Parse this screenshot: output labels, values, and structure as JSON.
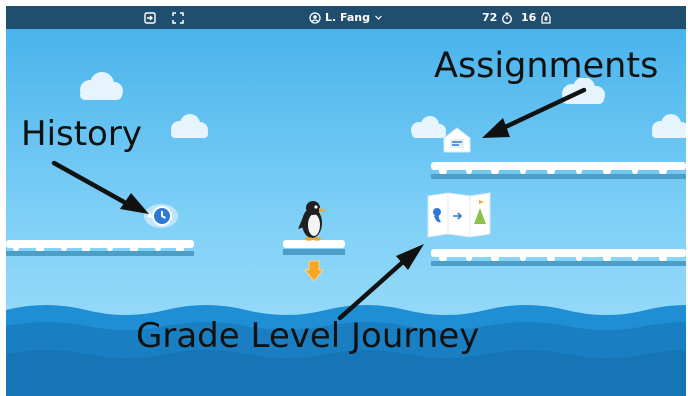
{
  "topbar": {
    "user_name": "L. Fang",
    "timer_value": "72",
    "coin_value": "16",
    "icons": [
      "exit-icon",
      "fullscreen-icon",
      "user-icon",
      "chevron-down-icon",
      "timer-icon",
      "coin-icon"
    ]
  },
  "annotations": {
    "assignments": "Assignments",
    "history": "History",
    "journey": "Grade Level Journey"
  },
  "colors": {
    "topbar": "#1f4e6e",
    "sky": "#5cc1f1",
    "water": "#1f8ed4",
    "accent_icon": "#2e78d6"
  }
}
